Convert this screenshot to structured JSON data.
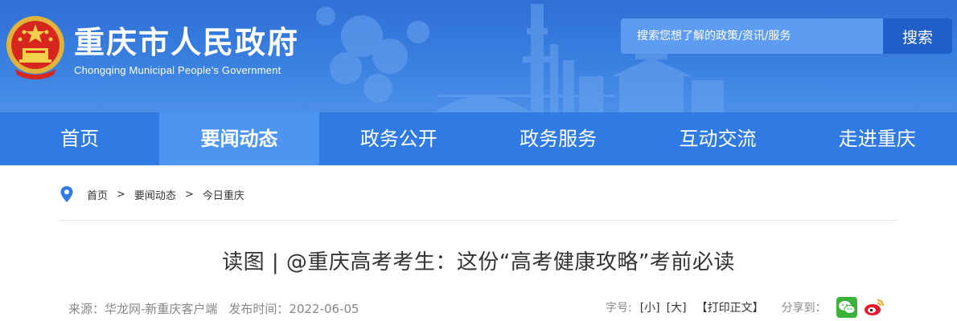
{
  "header": {
    "title": "重庆市人民政府",
    "subtitle": "Chongqing Municipal People's Government",
    "search_placeholder": "搜索您想了解的政策/资讯/服务",
    "search_button": "搜索"
  },
  "nav": {
    "items": [
      {
        "label": "首页"
      },
      {
        "label": "要闻动态"
      },
      {
        "label": "政务公开"
      },
      {
        "label": "政务服务"
      },
      {
        "label": "互动交流"
      },
      {
        "label": "走进重庆"
      }
    ],
    "active_index": 1
  },
  "breadcrumb": {
    "items": [
      "首页",
      "要闻动态",
      "今日重庆"
    ],
    "separator": ">"
  },
  "article": {
    "title": "读图 | @重庆高考考生：这份“高考健康攻略”考前必读",
    "source": "来源：华龙网-新重庆客户端",
    "published": "发布时间：2022-06-05"
  },
  "tools": {
    "font_label": "字号:",
    "font_small": "[小]",
    "font_large": "[大]",
    "print": "【打印正文】",
    "share_label": "分享到：",
    "share_icons": [
      "wechat-icon",
      "weibo-icon"
    ]
  },
  "colors": {
    "header_bg": "#3a80e0",
    "nav_bg": "#2f7be3",
    "nav_active": "#4d95f0",
    "search_button": "#1f5fc7"
  }
}
